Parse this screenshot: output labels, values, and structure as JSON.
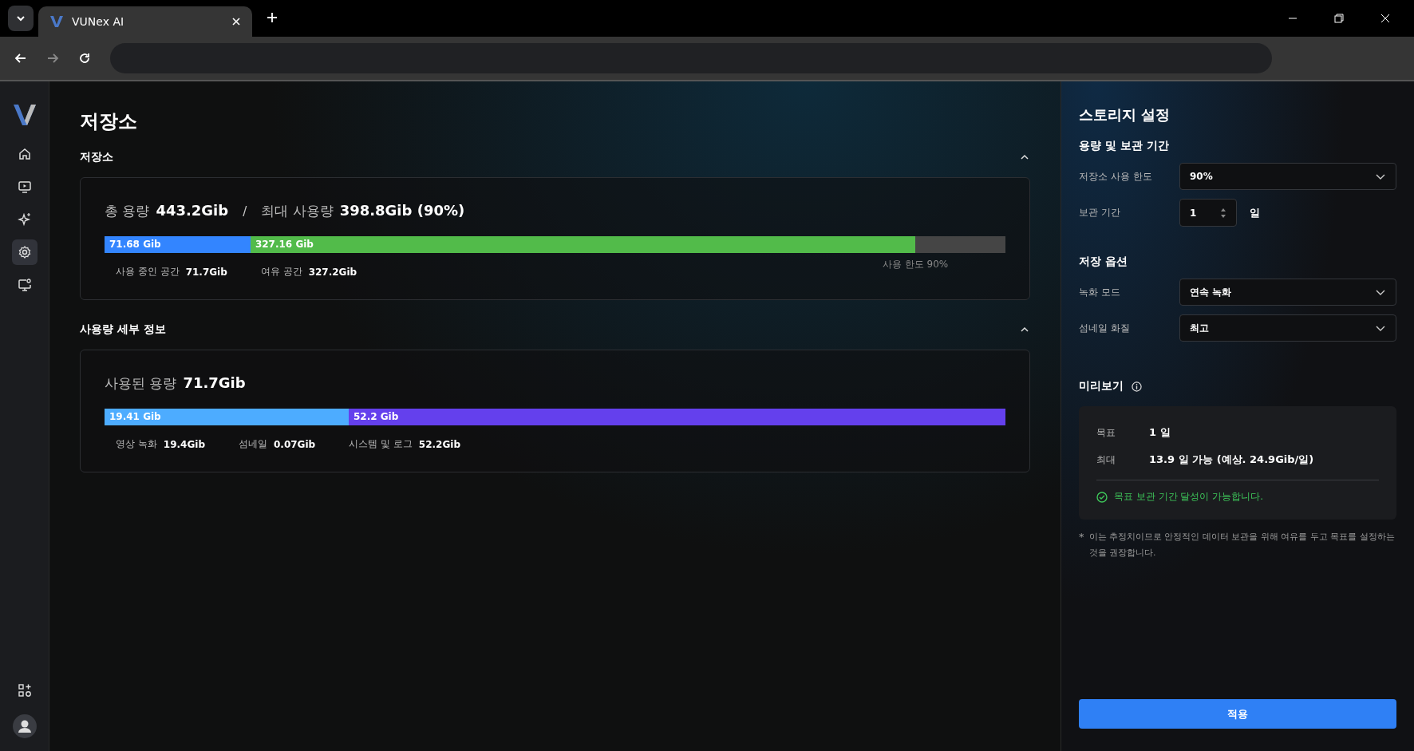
{
  "browser": {
    "tab_title": "VUNex AI",
    "tab_selected": true
  },
  "sidebar": {
    "items": [
      {
        "selected": false
      },
      {
        "selected": false
      },
      {
        "selected": false
      },
      {
        "selected": true
      },
      {
        "selected": false
      }
    ]
  },
  "page_title": "저장소",
  "sections": [
    {
      "heading": "저장소",
      "expanded": true,
      "summary": [
        {
          "label": "총 용량",
          "value": "443.2Gib"
        },
        {
          "label": "최대 사용량",
          "value": "398.8Gib (90%)"
        }
      ],
      "separator": "/",
      "bar": [
        {
          "label": "71.68 Gib",
          "level": 0.162,
          "color": "#3385ff"
        },
        {
          "label": "327.16 Gib",
          "level": 0.9,
          "color": "#52bb4a"
        }
      ],
      "limit_label": "사용 한도 90%",
      "legend": [
        {
          "label": "사용 중인 공간",
          "value": "71.7Gib"
        },
        {
          "label": "여유 공간",
          "value": "327.2Gib"
        }
      ]
    },
    {
      "heading": "사용량 세부 정보",
      "expanded": true,
      "summary": [
        {
          "label": "사용된 용량",
          "value": "71.7Gib"
        }
      ],
      "bar": [
        {
          "label": "19.41 Gib",
          "level": 0.271,
          "color": "#4dacff"
        },
        {
          "label": "52.2 Gib",
          "level": 1,
          "color": "#6440ed"
        }
      ],
      "legend": [
        {
          "label": "영상 녹화",
          "value": "19.4Gib"
        },
        {
          "label": "섬네일",
          "value": "0.07Gib"
        },
        {
          "label": "시스템 및 로그",
          "value": "52.2Gib"
        }
      ]
    }
  ],
  "settings": {
    "title": "스토리지 설정",
    "groups": [
      {
        "heading": "용량 및 보관 기간",
        "fields": [
          {
            "kind": "select",
            "label": "저장소 사용 한도",
            "value": "90%"
          },
          {
            "kind": "number",
            "label": "보관 기간",
            "value": "1",
            "unit": "일"
          }
        ]
      },
      {
        "heading": "저장 옵션",
        "fields": [
          {
            "kind": "select",
            "label": "녹화 모드",
            "value": "연속 녹화"
          },
          {
            "kind": "select",
            "label": "섬네일 화질",
            "value": "최고"
          }
        ]
      }
    ],
    "preview": {
      "heading": "미리보기",
      "rows": [
        {
          "label": "목표",
          "value": "1 일"
        },
        {
          "label": "최대",
          "value": "13.9 일 가능 (예상. 24.9Gib/일)"
        }
      ],
      "status": "목표 보관 기간 달성이 가능합니다.",
      "status_ok": true
    },
    "note_mark": "*",
    "note": "이는 추정치이므로 안정적인 데이터 보관을 위해 여유를 두고 목표를 설정하는 것을 권장합니다.",
    "apply_button": "적용"
  }
}
